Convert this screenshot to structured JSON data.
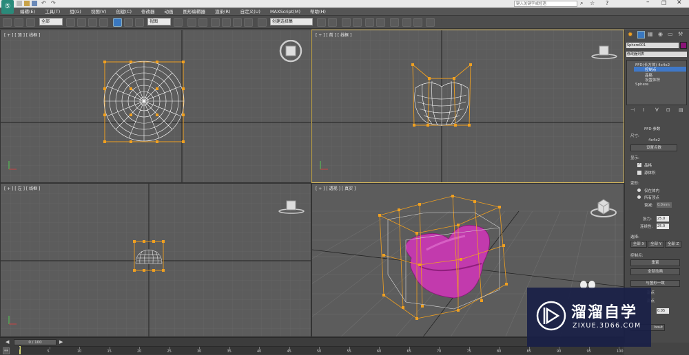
{
  "search": {
    "placeholder": "键入关键字或短语"
  },
  "menu": {
    "items": [
      "编辑(E)",
      "工具(T)",
      "组(G)",
      "视图(V)",
      "创建(C)",
      "修改器",
      "动画",
      "图形编辑器",
      "渲染(R)",
      "自定义(U)",
      "MAXScript(M)",
      "帮助(H)"
    ]
  },
  "toolbar": {
    "filter_value": "全部",
    "refcoord_value": "视图",
    "selection_set_value": "创建选择集"
  },
  "viewports": {
    "top": {
      "label": "[ + ] [ 顶 ] [ 线框 ]"
    },
    "front": {
      "label": "[ + ] [ 前 ] [ 线框 ]"
    },
    "left": {
      "label": "[ + ] [ 左 ] [ 线框 ]"
    },
    "perspective": {
      "label": "[ + ] [ 透视 ] [ 真实 ]"
    }
  },
  "command_panel": {
    "object_name": "Sphere001",
    "object_color": "#8a1478",
    "modifier_list": "修改器列表",
    "stack": [
      {
        "label": "FFD(长方体) 4x4x2",
        "selected": false
      },
      {
        "label": "控制点",
        "selected": true
      },
      {
        "label": "晶格",
        "selected": false
      },
      {
        "label": "设置体积",
        "selected": false
      },
      {
        "label": "Sphere",
        "selected": false
      }
    ],
    "rollout_title": "FFD 参数",
    "dimensions_label": "尺寸:",
    "dimensions_value": "4x4x2",
    "set_points_button": "设置点数",
    "display_label": "显示:",
    "lattice_checkbox": "晶格",
    "source_volume_checkbox": "源体积",
    "deform_label": "变形:",
    "only_in_volume": "仅在体内",
    "all_vertices": "所有顶点",
    "falloff_label": "衰减:",
    "falloff_value": "0.0mm",
    "tension_label": "张力:",
    "tension_value": "25.0",
    "continuity_label": "连续性:",
    "continuity_value": "25.0",
    "select_label": "选择:",
    "all_x": "全部 X",
    "all_y": "全部 Y",
    "all_z": "全部 Z",
    "control_points_label": "控制点:",
    "reset_button": "重置",
    "animate_all_button": "全部动画",
    "conform_button": "与图形一致",
    "inside_points": "部点",
    "outside_points": "部点",
    "offset_value": "0.05",
    "about_button": "bout"
  },
  "timeline": {
    "frame_label": "0 / 100",
    "ticks": [
      "0",
      "5",
      "10",
      "15",
      "20",
      "25",
      "30",
      "35",
      "40",
      "45",
      "50",
      "55",
      "60",
      "65",
      "70",
      "75",
      "80",
      "85",
      "90",
      "95",
      "100"
    ]
  },
  "watermark": {
    "brand": "溜溜自学",
    "url": "ZIXUE.3D66.COM"
  },
  "colors": {
    "ffd_lattice": "#f0a020",
    "object_fill": "#c23aad",
    "active_border": "#d6b85a"
  }
}
